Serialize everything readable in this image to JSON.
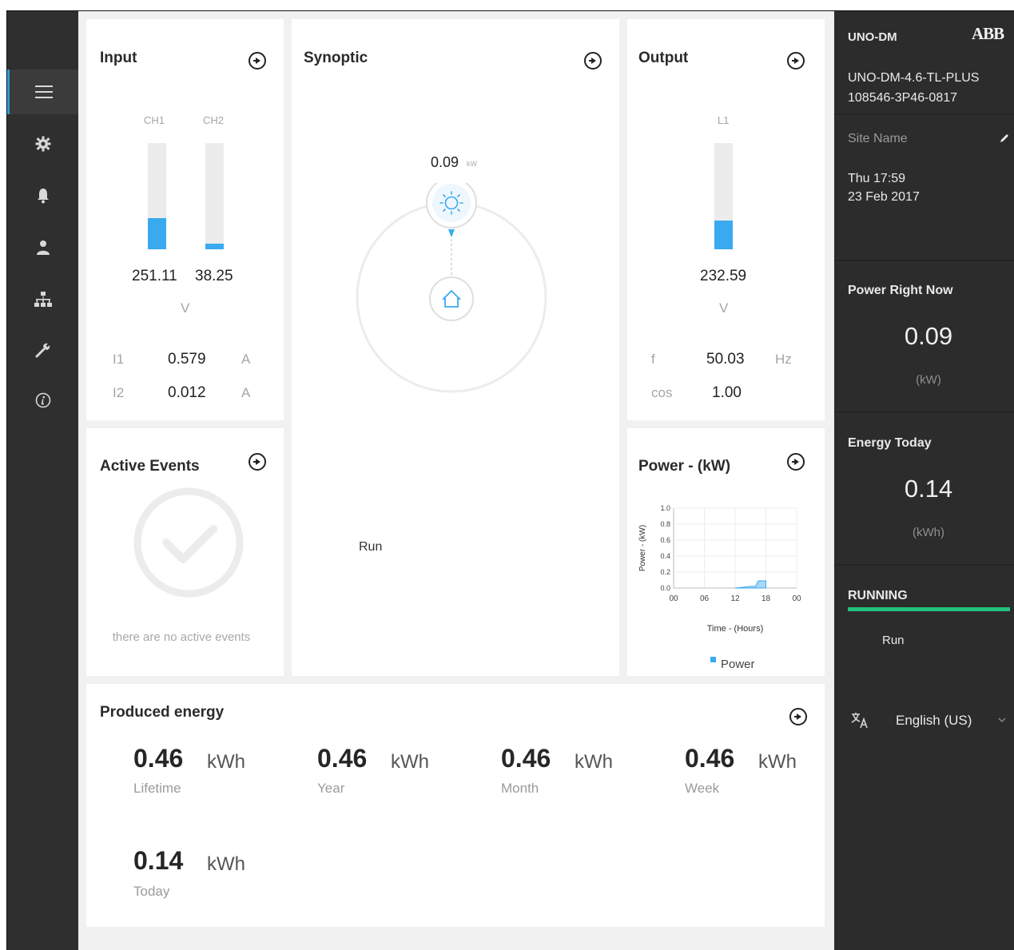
{
  "nav": {
    "items": [
      {
        "name": "menu-icon"
      },
      {
        "name": "gear-icon"
      },
      {
        "name": "bell-icon"
      },
      {
        "name": "user-icon"
      },
      {
        "name": "network-icon"
      },
      {
        "name": "wrench-icon"
      },
      {
        "name": "info-icon"
      }
    ]
  },
  "input": {
    "title": "Input",
    "ch1_label": "CH1",
    "ch2_label": "CH2",
    "ch1_value": "251.11",
    "ch2_value": "38.25",
    "ch1_level": 0.29,
    "ch2_level": 0.05,
    "voltage_unit": "V",
    "i1_label": "I1",
    "i1_value": "0.579",
    "i1_unit": "A",
    "i2_label": "I2",
    "i2_value": "0.012",
    "i2_unit": "A"
  },
  "synoptic": {
    "title": "Synoptic",
    "power_value": "0.09",
    "power_unit": "kW",
    "status": "Run"
  },
  "output": {
    "title": "Output",
    "l1_label": "L1",
    "l1_value": "232.59",
    "l1_level": 0.27,
    "voltage_unit": "V",
    "f_label": "f",
    "f_value": "50.03",
    "f_unit": "Hz",
    "cos_label": "cos",
    "cos_value": "1.00"
  },
  "events": {
    "title": "Active Events",
    "empty_text": "there are no active events"
  },
  "power_chart": {
    "title": "Power - (kW)"
  },
  "chart_data": {
    "type": "area",
    "title": "Power - (kW)",
    "xlabel": "Time - (Hours)",
    "ylabel": "Power - (kW)",
    "x_ticks": [
      "00",
      "06",
      "12",
      "18",
      "00"
    ],
    "y_ticks": [
      "1.0",
      "0.8",
      "0.6",
      "0.4",
      "0.2",
      "0.0"
    ],
    "ylim": [
      0,
      1.0
    ],
    "xlim": [
      0,
      24
    ],
    "series": [
      {
        "name": "Power",
        "x": [
          12,
          15,
          16,
          16.5,
          18
        ],
        "values": [
          0,
          0.02,
          0.02,
          0.09,
          0.09
        ]
      }
    ],
    "legend": "bottom",
    "grid": true,
    "color": "#3aaaf0"
  },
  "produced": {
    "title": "Produced energy",
    "items": [
      {
        "value": "0.46",
        "unit": "kWh",
        "label": "Lifetime"
      },
      {
        "value": "0.46",
        "unit": "kWh",
        "label": "Year"
      },
      {
        "value": "0.46",
        "unit": "kWh",
        "label": "Month"
      },
      {
        "value": "0.46",
        "unit": "kWh",
        "label": "Week"
      },
      {
        "value": "0.14",
        "unit": "kWh",
        "label": "Today"
      }
    ]
  },
  "right": {
    "device_short": "UNO-DM",
    "brand": "ABB",
    "model": "UNO-DM-4.6-TL-PLUS",
    "serial": "108546-3P46-0817",
    "site_name": "Site Name",
    "datetime_line1": "Thu 17:59",
    "datetime_line2": "23 Feb 2017",
    "power_now_label": "Power Right Now",
    "power_now_value": "0.09",
    "power_now_unit": "(kW)",
    "energy_today_label": "Energy Today",
    "energy_today_value": "0.14",
    "energy_today_unit": "(kWh)",
    "state_label": "RUNNING",
    "state_detail": "Run",
    "language": "English (US)",
    "accent": "#22c17c"
  }
}
